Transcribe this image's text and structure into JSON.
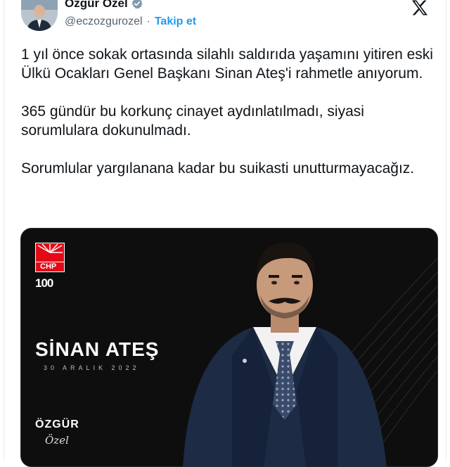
{
  "author": {
    "name": "Özgür Ozel",
    "handle": "@eczozgurozel",
    "separator": "·",
    "follow_label": "Takip et"
  },
  "icons": {
    "verified": "verified-badge-icon",
    "platform": "x-logo-icon"
  },
  "colors": {
    "link": "#1d9bf0",
    "verified": "#829aab",
    "text": "#0f1419",
    "muted": "#536471",
    "chp_red": "#e30a17"
  },
  "tweet": {
    "paragraphs": [
      "1 yıl önce sokak ortasında silahlı saldırıda yaşamını yitiren eski Ülkü Ocakları Genel Başkanı Sinan Ateş'i rahmetle anıyorum.",
      "365 gündür bu korkunç cinayet aydınlatılmadı, siyasi sorumlulara dokunulmadı.",
      "Sorumlular yargılanana kadar bu suikasti unutturmayacağız."
    ]
  },
  "media": {
    "party_logo_text": "CHP",
    "centennial_text": "100",
    "person_name": "SİNAN ATEŞ",
    "date_text": "30 ARALIK 2022",
    "brand_text": "ÖZGÜR",
    "signature_text": "Özel"
  }
}
